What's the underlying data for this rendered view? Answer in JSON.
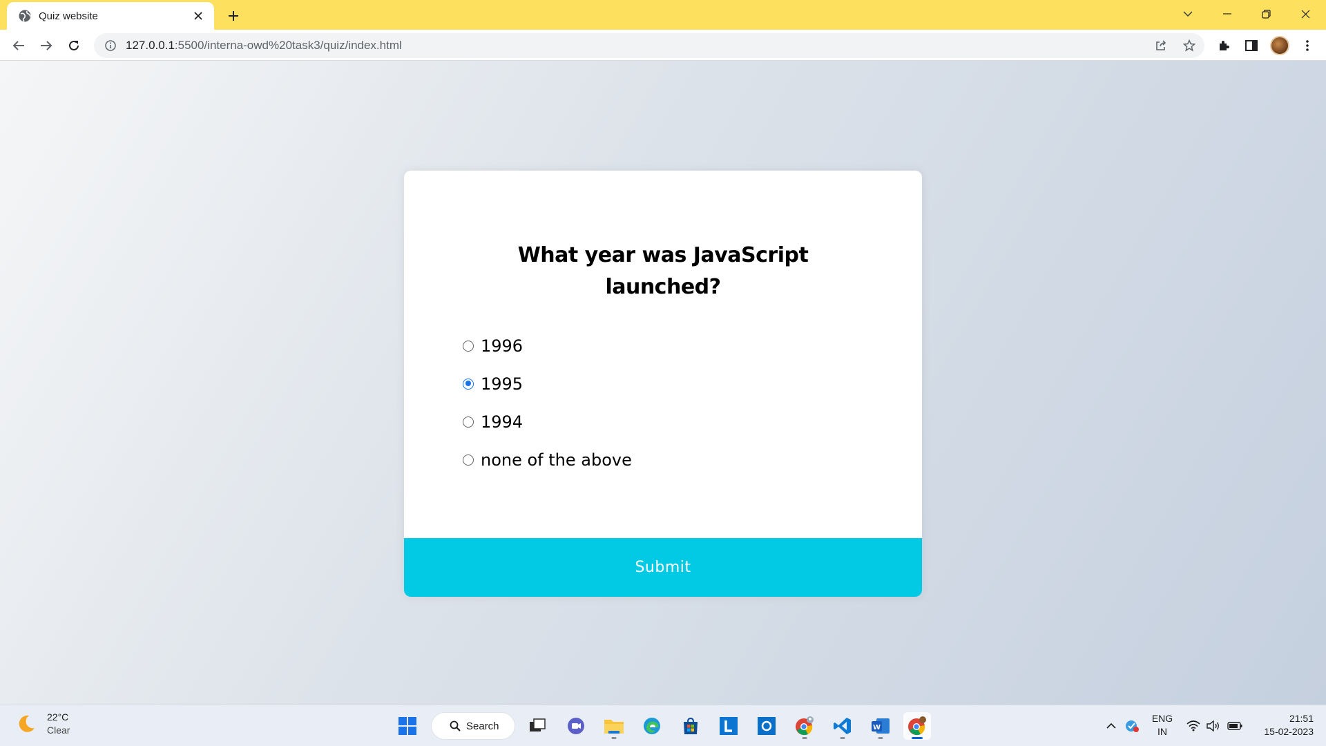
{
  "browser": {
    "tab_title": "Quiz website",
    "url_host": "127.0.0.1",
    "url_rest": ":5500/interna-owd%20task3/quiz/index.html",
    "tab_icon": "globe-icon",
    "theme_color": "#fde05d"
  },
  "quiz": {
    "question": "What year was JavaScript launched?",
    "answers": [
      {
        "label": "1996",
        "selected": false
      },
      {
        "label": "1995",
        "selected": true
      },
      {
        "label": "1994",
        "selected": false
      },
      {
        "label": "none of the above",
        "selected": false
      }
    ],
    "submit_label": "Submit",
    "accent_color": "#03cae4"
  },
  "taskbar": {
    "weather_temp": "22°C",
    "weather_desc": "Clear",
    "search_label": "Search",
    "lang_line1": "ENG",
    "lang_line2": "IN",
    "time": "21:51",
    "date": "15-02-2023",
    "apps": [
      "start-icon",
      "search",
      "task-view-icon",
      "teams-icon",
      "file-explorer-icon",
      "edge-icon",
      "store-icon",
      "l-app-icon",
      "blue-app-icon",
      "chrome-profile-icon",
      "vscode-icon",
      "word-icon",
      "chrome-icon"
    ]
  }
}
